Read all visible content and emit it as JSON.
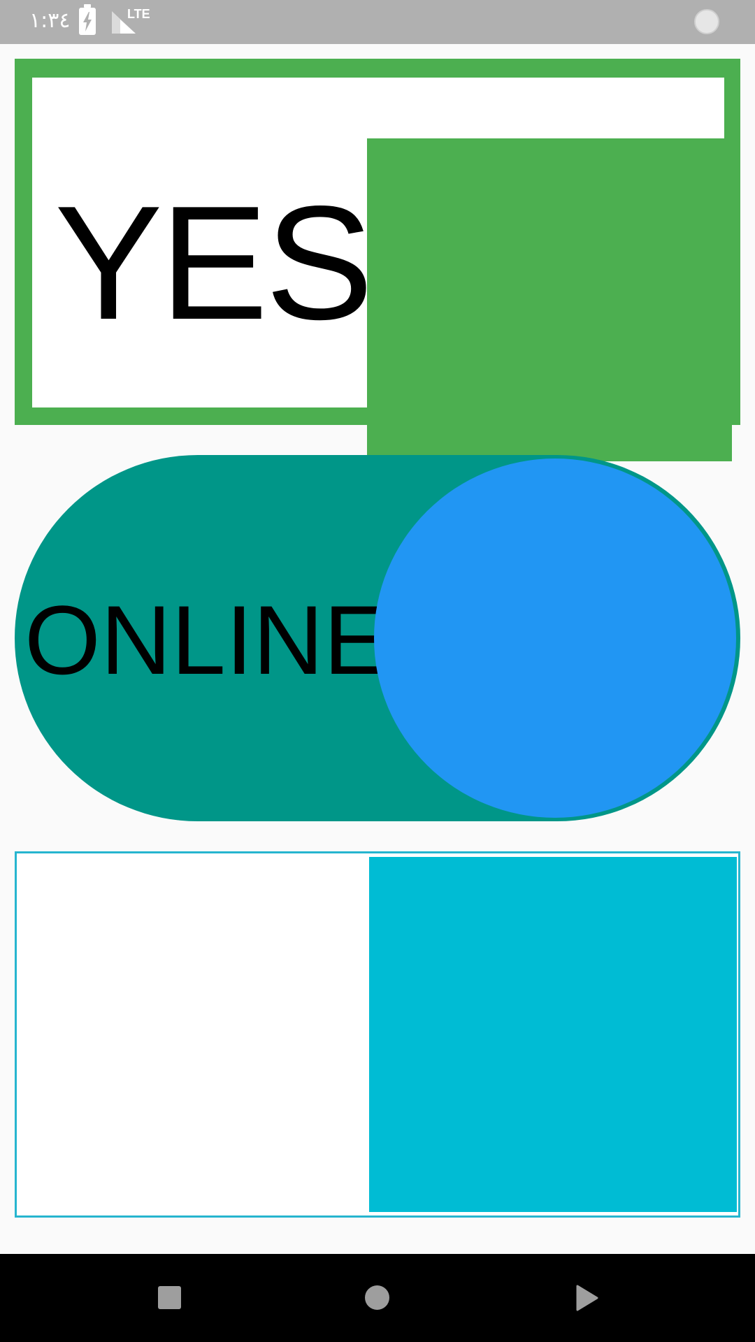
{
  "status_bar": {
    "time": "١:٣٤",
    "network_label": "LTE",
    "icons": [
      "battery-charging-icon",
      "signal-icon",
      "notification-dot-icon"
    ]
  },
  "toggles": [
    {
      "label": "YES",
      "state": "on",
      "track_color": "#4caf50",
      "knob_color": "#4caf50",
      "style": "rectangle"
    },
    {
      "label": "ONLINE",
      "state": "on",
      "track_color": "#009688",
      "knob_color": "#2196f3",
      "style": "rounded"
    },
    {
      "label": "",
      "state": "on",
      "track_color": "#26b5cf",
      "knob_color": "#00bcd4",
      "style": "rectangle-outline"
    }
  ],
  "nav_bar": {
    "icons": [
      "recents-square-icon",
      "home-circle-icon",
      "back-triangle-icon"
    ]
  }
}
